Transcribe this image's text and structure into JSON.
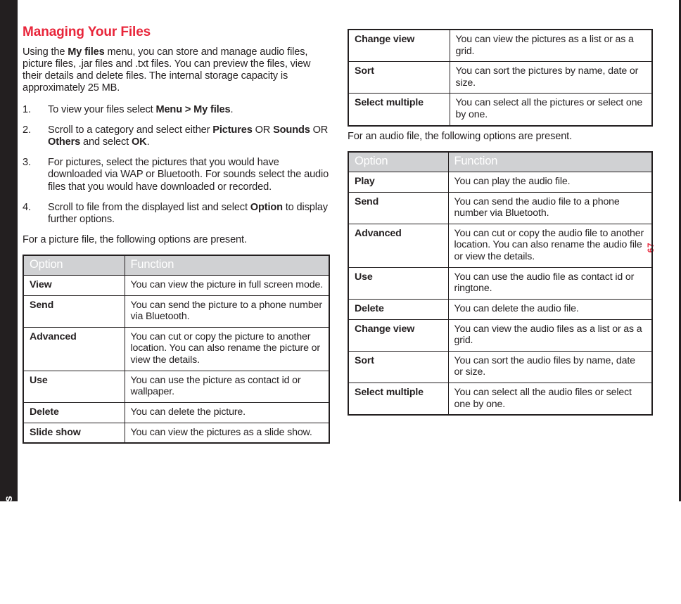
{
  "spine": {
    "label": "Managing Your Files"
  },
  "page": {
    "number": "67"
  },
  "section": {
    "title": "Managing Your Files",
    "intro_1": "Using the ",
    "intro_bold": "My files",
    "intro_2": " menu, you can store and manage audio files, picture files, .jar files and .txt files. You can preview the files, view their details and delete files. The internal storage capacity is approximately 25 MB."
  },
  "steps": [
    {
      "num": "1.",
      "parts": [
        {
          "text": "To view your files select ",
          "bold": false
        },
        {
          "text": "Menu > My files",
          "bold": true
        },
        {
          "text": ".",
          "bold": false
        }
      ]
    },
    {
      "num": "2.",
      "parts": [
        {
          "text": "Scroll to a category and select either ",
          "bold": false
        },
        {
          "text": "Pictures",
          "bold": true
        },
        {
          "text": " OR ",
          "bold": false
        },
        {
          "text": "Sounds",
          "bold": true
        },
        {
          "text": " OR ",
          "bold": false
        },
        {
          "text": "Others",
          "bold": true
        },
        {
          "text": " and select ",
          "bold": false
        },
        {
          "text": "OK",
          "bold": true
        },
        {
          "text": ".",
          "bold": false
        }
      ]
    },
    {
      "num": "3.",
      "parts": [
        {
          "text": "For pictures, select the pictures that you would have downloaded via WAP or Bluetooth. For sounds select the audio files that you would have downloaded or recorded.",
          "bold": false
        }
      ]
    },
    {
      "num": "4.",
      "parts": [
        {
          "text": "Scroll to file from the displayed list and select ",
          "bold": false
        },
        {
          "text": "Option",
          "bold": true
        },
        {
          "text": " to display further options.",
          "bold": false
        }
      ]
    }
  ],
  "picture_lead_in": "For a picture file, the following options are present.",
  "audio_lead_in": "For an audio file, the following options are present.",
  "picture_table": {
    "headers": [
      "Option",
      "Function"
    ],
    "rows": [
      [
        "View",
        "You can view the picture in full screen mode."
      ],
      [
        "Send",
        "You can send the picture to a phone number via Bluetooth."
      ],
      [
        "Advanced",
        "You can cut or copy the picture to another location. You can also rename the picture or view the details."
      ],
      [
        "Use",
        "You can use the picture as contact id or wallpaper."
      ],
      [
        "Delete",
        "You can delete the picture."
      ],
      [
        "Slide show",
        "You can view the pictures as a slide show."
      ]
    ]
  },
  "picture_table_cont": {
    "rows": [
      [
        "Change view",
        "You can view the pictures as a list or as a grid."
      ],
      [
        "Sort",
        "You can sort the pictures by name, date or size."
      ],
      [
        "Select multiple",
        "You can select all the pictures or select one by one."
      ]
    ]
  },
  "audio_table": {
    "headers": [
      "Option",
      "Function"
    ],
    "rows": [
      [
        "Play",
        "You can play the audio file."
      ],
      [
        "Send",
        "You can send the audio file to a phone number via Bluetooth."
      ],
      [
        "Advanced",
        "You can cut or copy the audio file to another location. You can also rename the audio file or view the details."
      ],
      [
        "Use",
        "You can use the audio file as contact id or ringtone."
      ],
      [
        "Delete",
        "You can delete the audio file."
      ],
      [
        "Change view",
        "You can view the audio files as a list or as a grid."
      ],
      [
        "Sort",
        "You can sort the audio files by name, date or size."
      ],
      [
        "Select multiple",
        "You can select all the audio files or select one by one."
      ]
    ]
  },
  "colors": {
    "accent_red": "#e8253a",
    "spine_dark": "#231f20",
    "table_header_bg": "#d0d1d3"
  }
}
